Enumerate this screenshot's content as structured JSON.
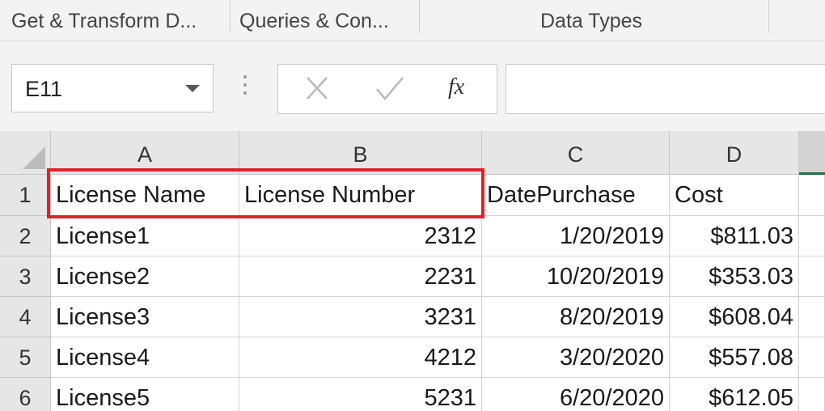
{
  "ribbon": {
    "groups": [
      {
        "label": "Get & Transform D..."
      },
      {
        "label": "Queries & Con..."
      },
      {
        "label": "Data Types"
      }
    ]
  },
  "formula_bar": {
    "name_box_value": "E11",
    "cancel_icon": "close-icon",
    "enter_icon": "check-icon",
    "fx_label": "fx",
    "formula_value": ""
  },
  "sheet": {
    "columns": [
      "A",
      "B",
      "C",
      "D"
    ],
    "rows": [
      {
        "num": "1",
        "cells": [
          "License Name",
          "License Number",
          "DatePurchase",
          "Cost"
        ]
      },
      {
        "num": "2",
        "cells": [
          "License1",
          "2312",
          "1/20/2019",
          "$811.03"
        ]
      },
      {
        "num": "3",
        "cells": [
          "License2",
          "2231",
          "10/20/2019",
          "$353.03"
        ]
      },
      {
        "num": "4",
        "cells": [
          "License3",
          "3231",
          "8/20/2019",
          "$608.04"
        ]
      },
      {
        "num": "5",
        "cells": [
          "License4",
          "4212",
          "3/20/2020",
          "$557.08"
        ]
      },
      {
        "num": "6",
        "cells": [
          "License5",
          "5231",
          "6/20/2020",
          "$612.05"
        ]
      }
    ]
  },
  "colors": {
    "highlight": "#e0212b",
    "selected_column_accent": "#1e7145"
  }
}
